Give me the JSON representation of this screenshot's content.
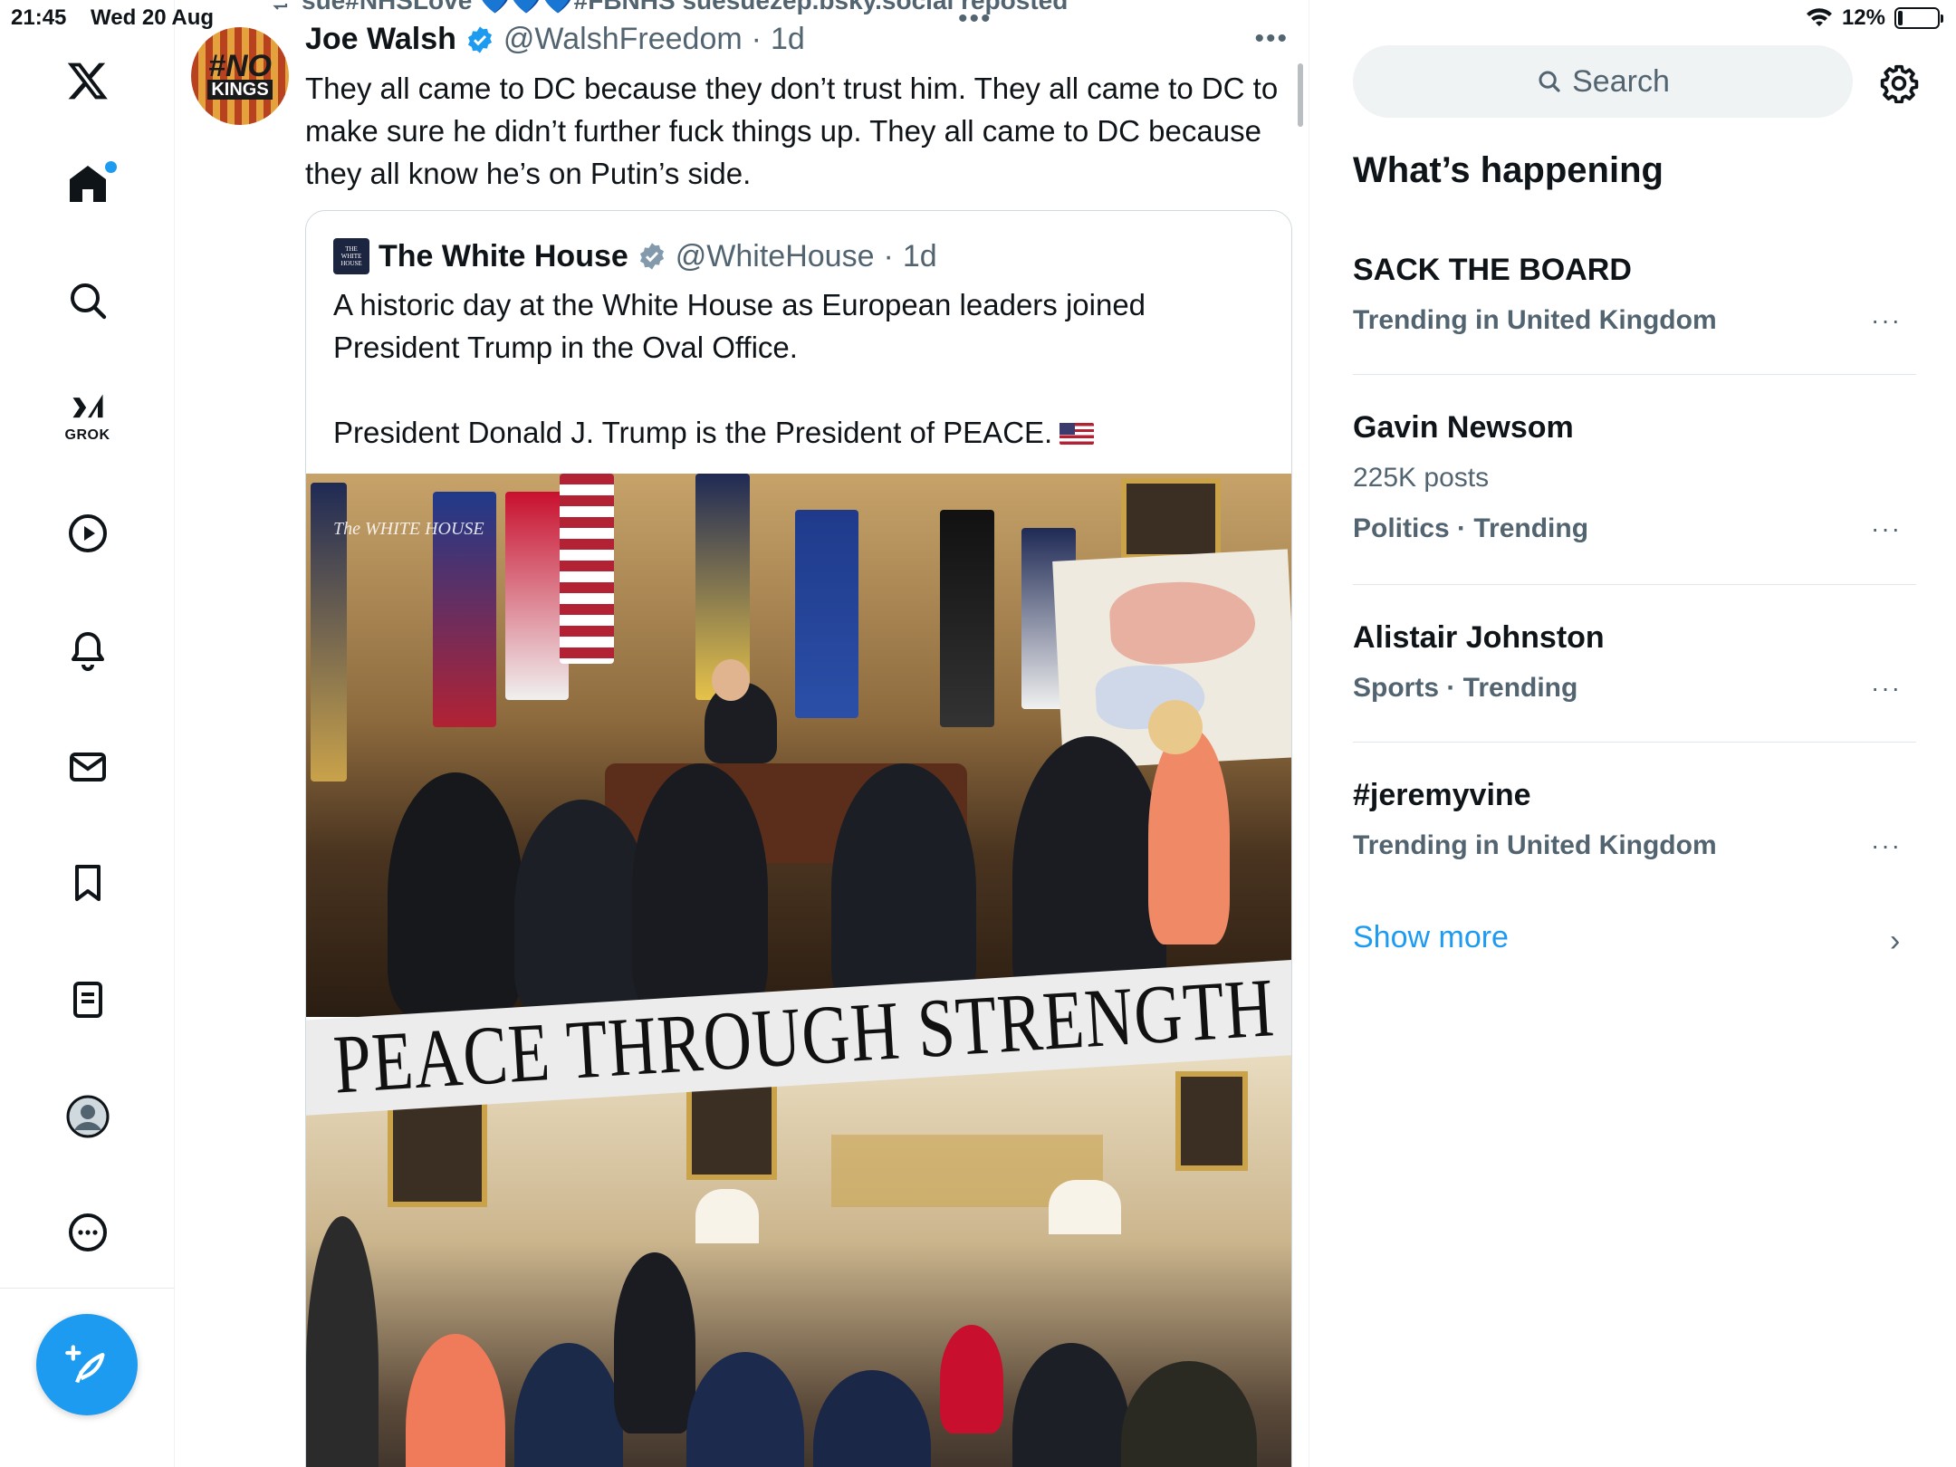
{
  "status": {
    "time": "21:45",
    "date": "Wed 20 Aug",
    "battery": "12%",
    "battery_level": 0.12
  },
  "nav": {
    "grok_label": "GROK"
  },
  "repost_bar": {
    "text": "sue#NHSLove 💙💙💙#FBNHS suesuezep.bsky.social reposted"
  },
  "tweet": {
    "avatar_text_1": "#NO",
    "avatar_text_2": "KINGS",
    "author_name": "Joe Walsh",
    "author_handle": "@WalshFreedom",
    "separator": "·",
    "time": "1d",
    "text": "They all came to DC because they don’t trust him. They all came to DC to make sure he didn’t further fuck things up. They all came to DC because they all know he’s on Putin’s side.",
    "more": "···"
  },
  "quote": {
    "author_name": "The White House",
    "author_handle": "@WhiteHouse",
    "separator": "·",
    "time": "1d",
    "paragraph_1": "A historic day at the White House as European leaders joined President Trump in the Oval Office.",
    "paragraph_2": "President Donald J. Trump is the President of PEACE.",
    "image_watermark": "The WHITE HOUSE",
    "image_banner": "PEACE THROUGH STRENGTH"
  },
  "right": {
    "search_placeholder": "Search",
    "section_title": "What’s happening",
    "trends": [
      {
        "name": "SACK THE BOARD",
        "context": "Trending in United Kingdom"
      },
      {
        "name": "Gavin Newsom",
        "posts": "225K posts",
        "context": "Politics · Trending"
      },
      {
        "name": "Alistair Johnston",
        "context": "Sports · Trending"
      },
      {
        "name": "#jeremyvine",
        "context": "Trending in United Kingdom"
      }
    ],
    "trend_more": "···",
    "show_more": "Show more",
    "show_more_chevron": "›"
  },
  "colors": {
    "accent": "#1d9bf0",
    "text_secondary": "#536471",
    "border": "#eff3f4"
  }
}
